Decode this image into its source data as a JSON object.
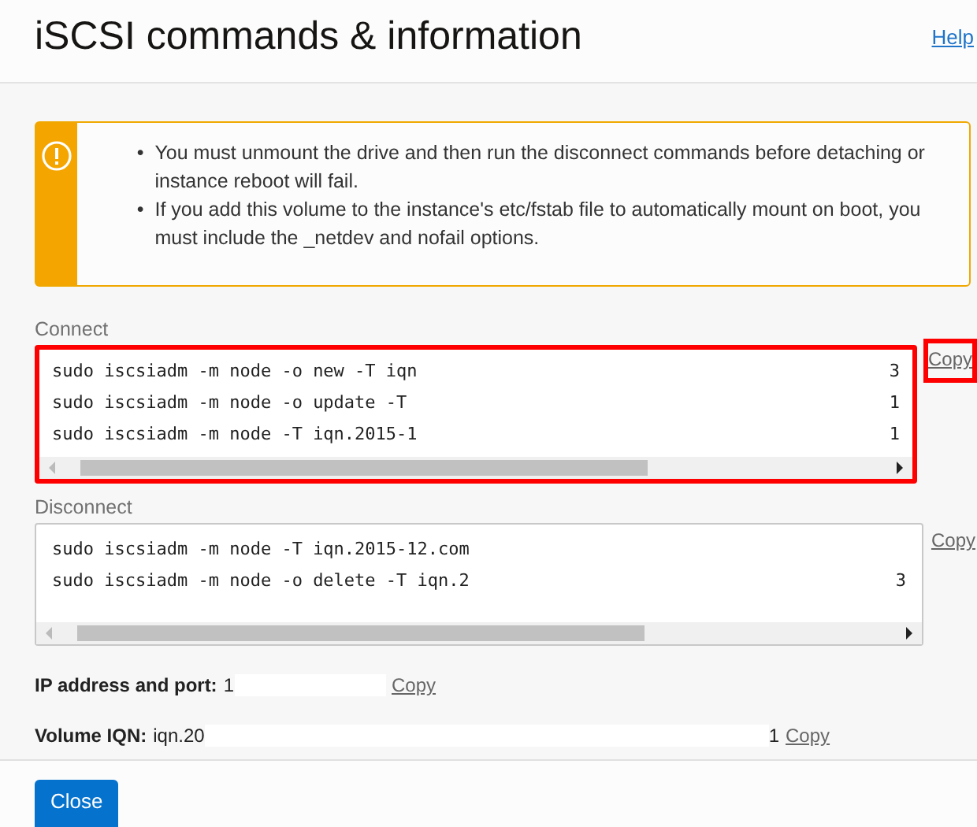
{
  "title": "iSCSI commands & information",
  "help": "Help",
  "alert": {
    "items": [
      {
        "marker": "•",
        "text": "You must unmount the drive and then run the disconnect commands before detaching or instance reboot will fail."
      },
      {
        "marker": "•",
        "text": "If you add this volume to the instance's etc/fstab file to automatically mount on boot, you must include the _netdev and nofail options."
      }
    ]
  },
  "sections": [
    {
      "label": "Connect",
      "highlighted": true,
      "copy": "Copy",
      "lines": [
        {
          "text": "sudo iscsiadm -m node -o new -T iqn",
          "tail": "3"
        },
        {
          "text": "sudo iscsiadm -m node -o update -T",
          "tail": "1"
        },
        {
          "text": "sudo iscsiadm -m node -T iqn.2015-1",
          "tail": "1"
        }
      ]
    },
    {
      "label": "Disconnect",
      "highlighted": false,
      "copy": "Copy",
      "lines": [
        {
          "text": "sudo iscsiadm -m node -T iqn.2015-12.com"
        },
        {
          "text": "sudo iscsiadm -m node -o delete -T iqn.2",
          "tail": "3"
        }
      ]
    }
  ],
  "fields": [
    {
      "label": "IP address and port:",
      "value": "1",
      "copy": "Copy"
    },
    {
      "label": "Volume IQN:",
      "value": "iqn.20",
      "tail": "1",
      "copy": "Copy"
    }
  ],
  "close": "Close"
}
